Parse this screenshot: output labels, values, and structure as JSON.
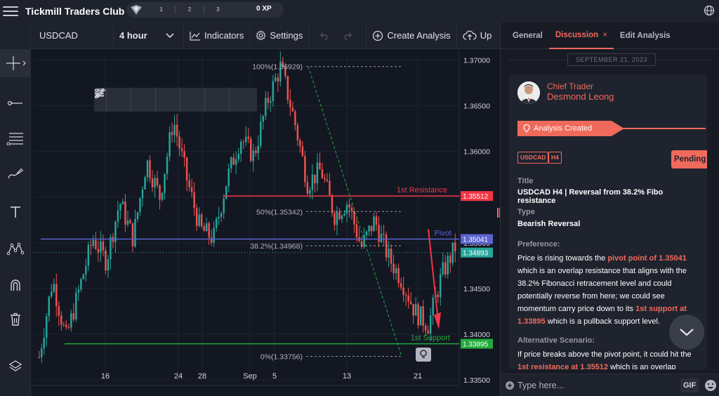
{
  "app": {
    "title": "Tickmill Traders Club",
    "xp_levels": [
      "1",
      "2",
      "3"
    ],
    "xp_value": "0 XP"
  },
  "toolbar": {
    "symbol": "USDCAD",
    "interval": "4 hour",
    "indicators_label": "Indicators",
    "settings_label": "Settings",
    "create_analysis_label": "Create Analysis",
    "upload_label": "Up"
  },
  "chart_data": {
    "type": "candlestick",
    "ylim": [
      1.335,
      1.3705
    ],
    "y_ticks": [
      "1.37000",
      "1.36500",
      "1.36000",
      "1.35500",
      "1.35000",
      "1.34500",
      "1.34000",
      "1.33500"
    ],
    "y_tick_values": [
      1.37,
      1.365,
      1.36,
      1.355,
      1.35,
      1.345,
      1.34,
      1.335
    ],
    "x_ticks": [
      "16",
      "24",
      "28",
      "Sep",
      "5",
      "13",
      "21"
    ],
    "levels": [
      {
        "name": "1st Resistance",
        "value": 1.35512,
        "label": "1.35512",
        "color": "#f23645"
      },
      {
        "name": "Pivot",
        "value": 1.35041,
        "label": "1.35041",
        "color": "#5b63d3"
      },
      {
        "name": "1st Support",
        "value": 1.33895,
        "label": "1.33895",
        "color": "#22ab3c"
      }
    ],
    "current_price": {
      "value": 1.34893,
      "label": "1.34893",
      "color": "#26a69a"
    },
    "fibonacci": [
      {
        "label": "100%(1.36929)",
        "value": 1.36929
      },
      {
        "label": "50%(1.35342)",
        "value": 1.35342
      },
      {
        "label": "38.2%(1.34968)",
        "value": 1.34968
      },
      {
        "label": "0%(1.33756)",
        "value": 1.33756
      }
    ],
    "path_points": [
      1.3375,
      1.346,
      1.3395,
      1.345,
      1.3505,
      1.348,
      1.3545,
      1.3505,
      1.359,
      1.355,
      1.3635,
      1.357,
      1.3515,
      1.3505,
      1.357,
      1.3615,
      1.3595,
      1.3655,
      1.3693,
      1.3635,
      1.3565,
      1.358,
      1.353,
      1.3545,
      1.3495,
      1.3525,
      1.3485,
      1.346,
      1.3425,
      1.341,
      1.3465,
      1.3495
    ],
    "colors": {
      "up": "#26a69a",
      "down": "#ef5350",
      "grid": "#1f2330"
    }
  },
  "panel": {
    "tabs": [
      {
        "label": "General"
      },
      {
        "label": "Discussion",
        "close": "×"
      },
      {
        "label": "Edit Analysis"
      }
    ],
    "date": "SEPTEMBER 21, 2023",
    "author_role": "Chief Trader",
    "author_name": "Desmond Leong",
    "event": "Analysis Created",
    "badges": [
      "USDCAD",
      "H4"
    ],
    "status": "Pending",
    "title_label": "Title",
    "title_value": "USDCAD H4 | Reversal from 38.2% Fibo resistance",
    "type_label": "Type",
    "type_value": "Bearish Reversal",
    "preference_label": "Preference:",
    "preference_parts": [
      "Price is rising towards the ",
      "pivot point of 1.35041",
      " which is an overlap resistance that aligns with the 38.2% Fibonacci retracement level and could potentially reverse from here; we could see momentum carry price down to its ",
      "1st support at 1.33895",
      " which is a pullback support level."
    ],
    "alt_label": "Alternative Scenario:",
    "alt_parts": [
      "If price breaks above the pivot point, it could hit the ",
      "1st resistance at 1.35512",
      " which is an overlap resistance."
    ],
    "composer_placeholder": "Type here...",
    "gif_label": "GIF"
  }
}
